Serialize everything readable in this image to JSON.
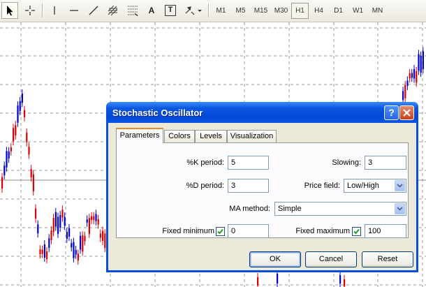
{
  "toolbar": {
    "tools": [
      {
        "icon": "cursor-arrow-icon"
      },
      {
        "icon": "crosshair-icon"
      },
      {
        "icon": "vertical-line-icon"
      },
      {
        "icon": "horizontal-line-icon"
      },
      {
        "icon": "trendline-icon"
      },
      {
        "icon": "equidistant-channel-icon"
      },
      {
        "icon": "fibonacci-retracement-icon"
      },
      {
        "icon": "text-tool-icon"
      },
      {
        "icon": "text-label-icon"
      },
      {
        "icon": "arrows-menu-icon"
      }
    ],
    "text_tool_label": "A",
    "text_label_label": "T",
    "timeframes": [
      "M1",
      "M5",
      "M15",
      "M30",
      "H1",
      "H4",
      "D1",
      "W1",
      "MN"
    ],
    "active_timeframe": "H1"
  },
  "dialog": {
    "title": "Stochastic Oscillator",
    "help_label": "?",
    "tabs": [
      "Parameters",
      "Colors",
      "Levels",
      "Visualization"
    ],
    "active_tab": "Parameters",
    "k_period_label": "%K period:",
    "k_period_value": "5",
    "slowing_label": "Slowing:",
    "slowing_value": "3",
    "d_period_label": "%D period:",
    "d_period_value": "3",
    "price_field_label": "Price field:",
    "price_field_value": "Low/High",
    "ma_method_label": "MA method:",
    "ma_method_value": "Simple",
    "fixed_minimum_label": "Fixed minimum",
    "fixed_minimum_checked": true,
    "fixed_minimum_value": "0",
    "fixed_maximum_label": "Fixed maximum",
    "fixed_maximum_checked": true,
    "fixed_maximum_value": "100",
    "ok_label": "OK",
    "cancel_label": "Cancel",
    "reset_label": "Reset"
  },
  "chart": {
    "up_color": "#0000cc",
    "down_color": "#dd0000",
    "grid_color": "#9a9a9a"
  }
}
